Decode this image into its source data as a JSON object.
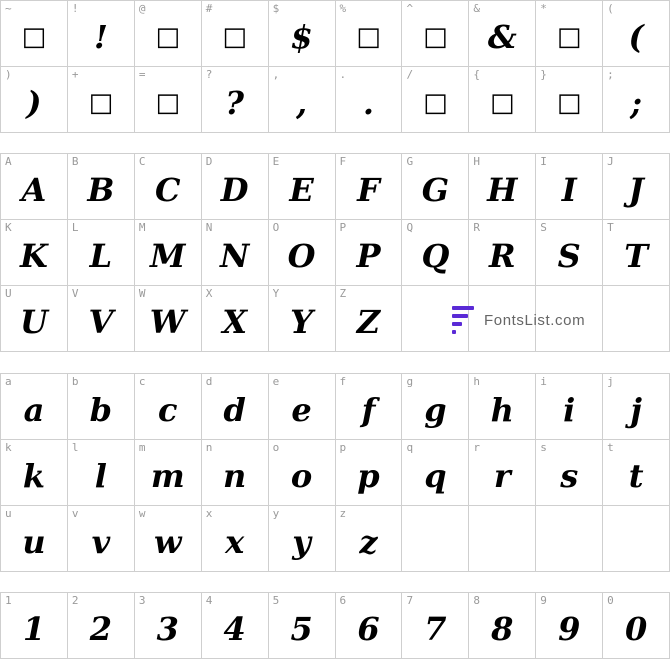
{
  "sections": [
    {
      "id": "symbols",
      "rows": [
        [
          {
            "k": "~",
            "g": "□",
            "box": true
          },
          {
            "k": "!",
            "g": "!"
          },
          {
            "k": "@",
            "g": "□",
            "box": true
          },
          {
            "k": "#",
            "g": "□",
            "box": true
          },
          {
            "k": "$",
            "g": "$"
          },
          {
            "k": "%",
            "g": "□",
            "box": true
          },
          {
            "k": "^",
            "g": "□",
            "box": true
          },
          {
            "k": "&",
            "g": "&"
          },
          {
            "k": "*",
            "g": "□",
            "box": true
          },
          {
            "k": "(",
            "g": "("
          }
        ],
        [
          {
            "k": ")",
            "g": ")"
          },
          {
            "k": "+",
            "g": "□",
            "box": true
          },
          {
            "k": "=",
            "g": "□",
            "box": true
          },
          {
            "k": "?",
            "g": "?"
          },
          {
            "k": ",",
            "g": ","
          },
          {
            "k": ".",
            "g": "."
          },
          {
            "k": "/",
            "g": "□",
            "box": true
          },
          {
            "k": "{",
            "g": "□",
            "box": true
          },
          {
            "k": "}",
            "g": "□",
            "box": true
          },
          {
            "k": ";",
            "g": ";"
          }
        ]
      ]
    },
    {
      "id": "uppercase",
      "rows": [
        [
          {
            "k": "A",
            "g": "A"
          },
          {
            "k": "B",
            "g": "B"
          },
          {
            "k": "C",
            "g": "C"
          },
          {
            "k": "D",
            "g": "D"
          },
          {
            "k": "E",
            "g": "E"
          },
          {
            "k": "F",
            "g": "F"
          },
          {
            "k": "G",
            "g": "G"
          },
          {
            "k": "H",
            "g": "H"
          },
          {
            "k": "I",
            "g": "I"
          },
          {
            "k": "J",
            "g": "J"
          }
        ],
        [
          {
            "k": "K",
            "g": "K"
          },
          {
            "k": "L",
            "g": "L"
          },
          {
            "k": "M",
            "g": "M"
          },
          {
            "k": "N",
            "g": "N"
          },
          {
            "k": "O",
            "g": "O"
          },
          {
            "k": "P",
            "g": "P"
          },
          {
            "k": "Q",
            "g": "Q"
          },
          {
            "k": "R",
            "g": "R"
          },
          {
            "k": "S",
            "g": "S"
          },
          {
            "k": "T",
            "g": "T"
          }
        ],
        [
          {
            "k": "U",
            "g": "U"
          },
          {
            "k": "V",
            "g": "V"
          },
          {
            "k": "W",
            "g": "W"
          },
          {
            "k": "X",
            "g": "X"
          },
          {
            "k": "Y",
            "g": "Y"
          },
          {
            "k": "Z",
            "g": "Z"
          },
          {
            "k": "",
            "g": ""
          },
          {
            "k": "",
            "g": ""
          },
          {
            "k": "",
            "g": ""
          },
          {
            "k": "",
            "g": ""
          }
        ]
      ]
    },
    {
      "id": "lowercase",
      "rows": [
        [
          {
            "k": "a",
            "g": "a"
          },
          {
            "k": "b",
            "g": "b"
          },
          {
            "k": "c",
            "g": "c"
          },
          {
            "k": "d",
            "g": "d"
          },
          {
            "k": "e",
            "g": "e"
          },
          {
            "k": "f",
            "g": "f"
          },
          {
            "k": "g",
            "g": "g"
          },
          {
            "k": "h",
            "g": "h"
          },
          {
            "k": "i",
            "g": "i"
          },
          {
            "k": "j",
            "g": "j"
          }
        ],
        [
          {
            "k": "k",
            "g": "k"
          },
          {
            "k": "l",
            "g": "l"
          },
          {
            "k": "m",
            "g": "m"
          },
          {
            "k": "n",
            "g": "n"
          },
          {
            "k": "o",
            "g": "o"
          },
          {
            "k": "p",
            "g": "p"
          },
          {
            "k": "q",
            "g": "q"
          },
          {
            "k": "r",
            "g": "r"
          },
          {
            "k": "s",
            "g": "s"
          },
          {
            "k": "t",
            "g": "t"
          }
        ],
        [
          {
            "k": "u",
            "g": "u"
          },
          {
            "k": "v",
            "g": "v"
          },
          {
            "k": "w",
            "g": "w"
          },
          {
            "k": "x",
            "g": "x"
          },
          {
            "k": "y",
            "g": "y"
          },
          {
            "k": "z",
            "g": "z"
          },
          {
            "k": "",
            "g": ""
          },
          {
            "k": "",
            "g": ""
          },
          {
            "k": "",
            "g": ""
          },
          {
            "k": "",
            "g": ""
          }
        ]
      ]
    },
    {
      "id": "digits",
      "rows": [
        [
          {
            "k": "1",
            "g": "1"
          },
          {
            "k": "2",
            "g": "2"
          },
          {
            "k": "3",
            "g": "3"
          },
          {
            "k": "4",
            "g": "4"
          },
          {
            "k": "5",
            "g": "5"
          },
          {
            "k": "6",
            "g": "6"
          },
          {
            "k": "7",
            "g": "7"
          },
          {
            "k": "8",
            "g": "8"
          },
          {
            "k": "9",
            "g": "9"
          },
          {
            "k": "0",
            "g": "0"
          }
        ]
      ]
    }
  ],
  "watermark": {
    "text": "FontsList.com",
    "color": "#5a2ad6"
  }
}
